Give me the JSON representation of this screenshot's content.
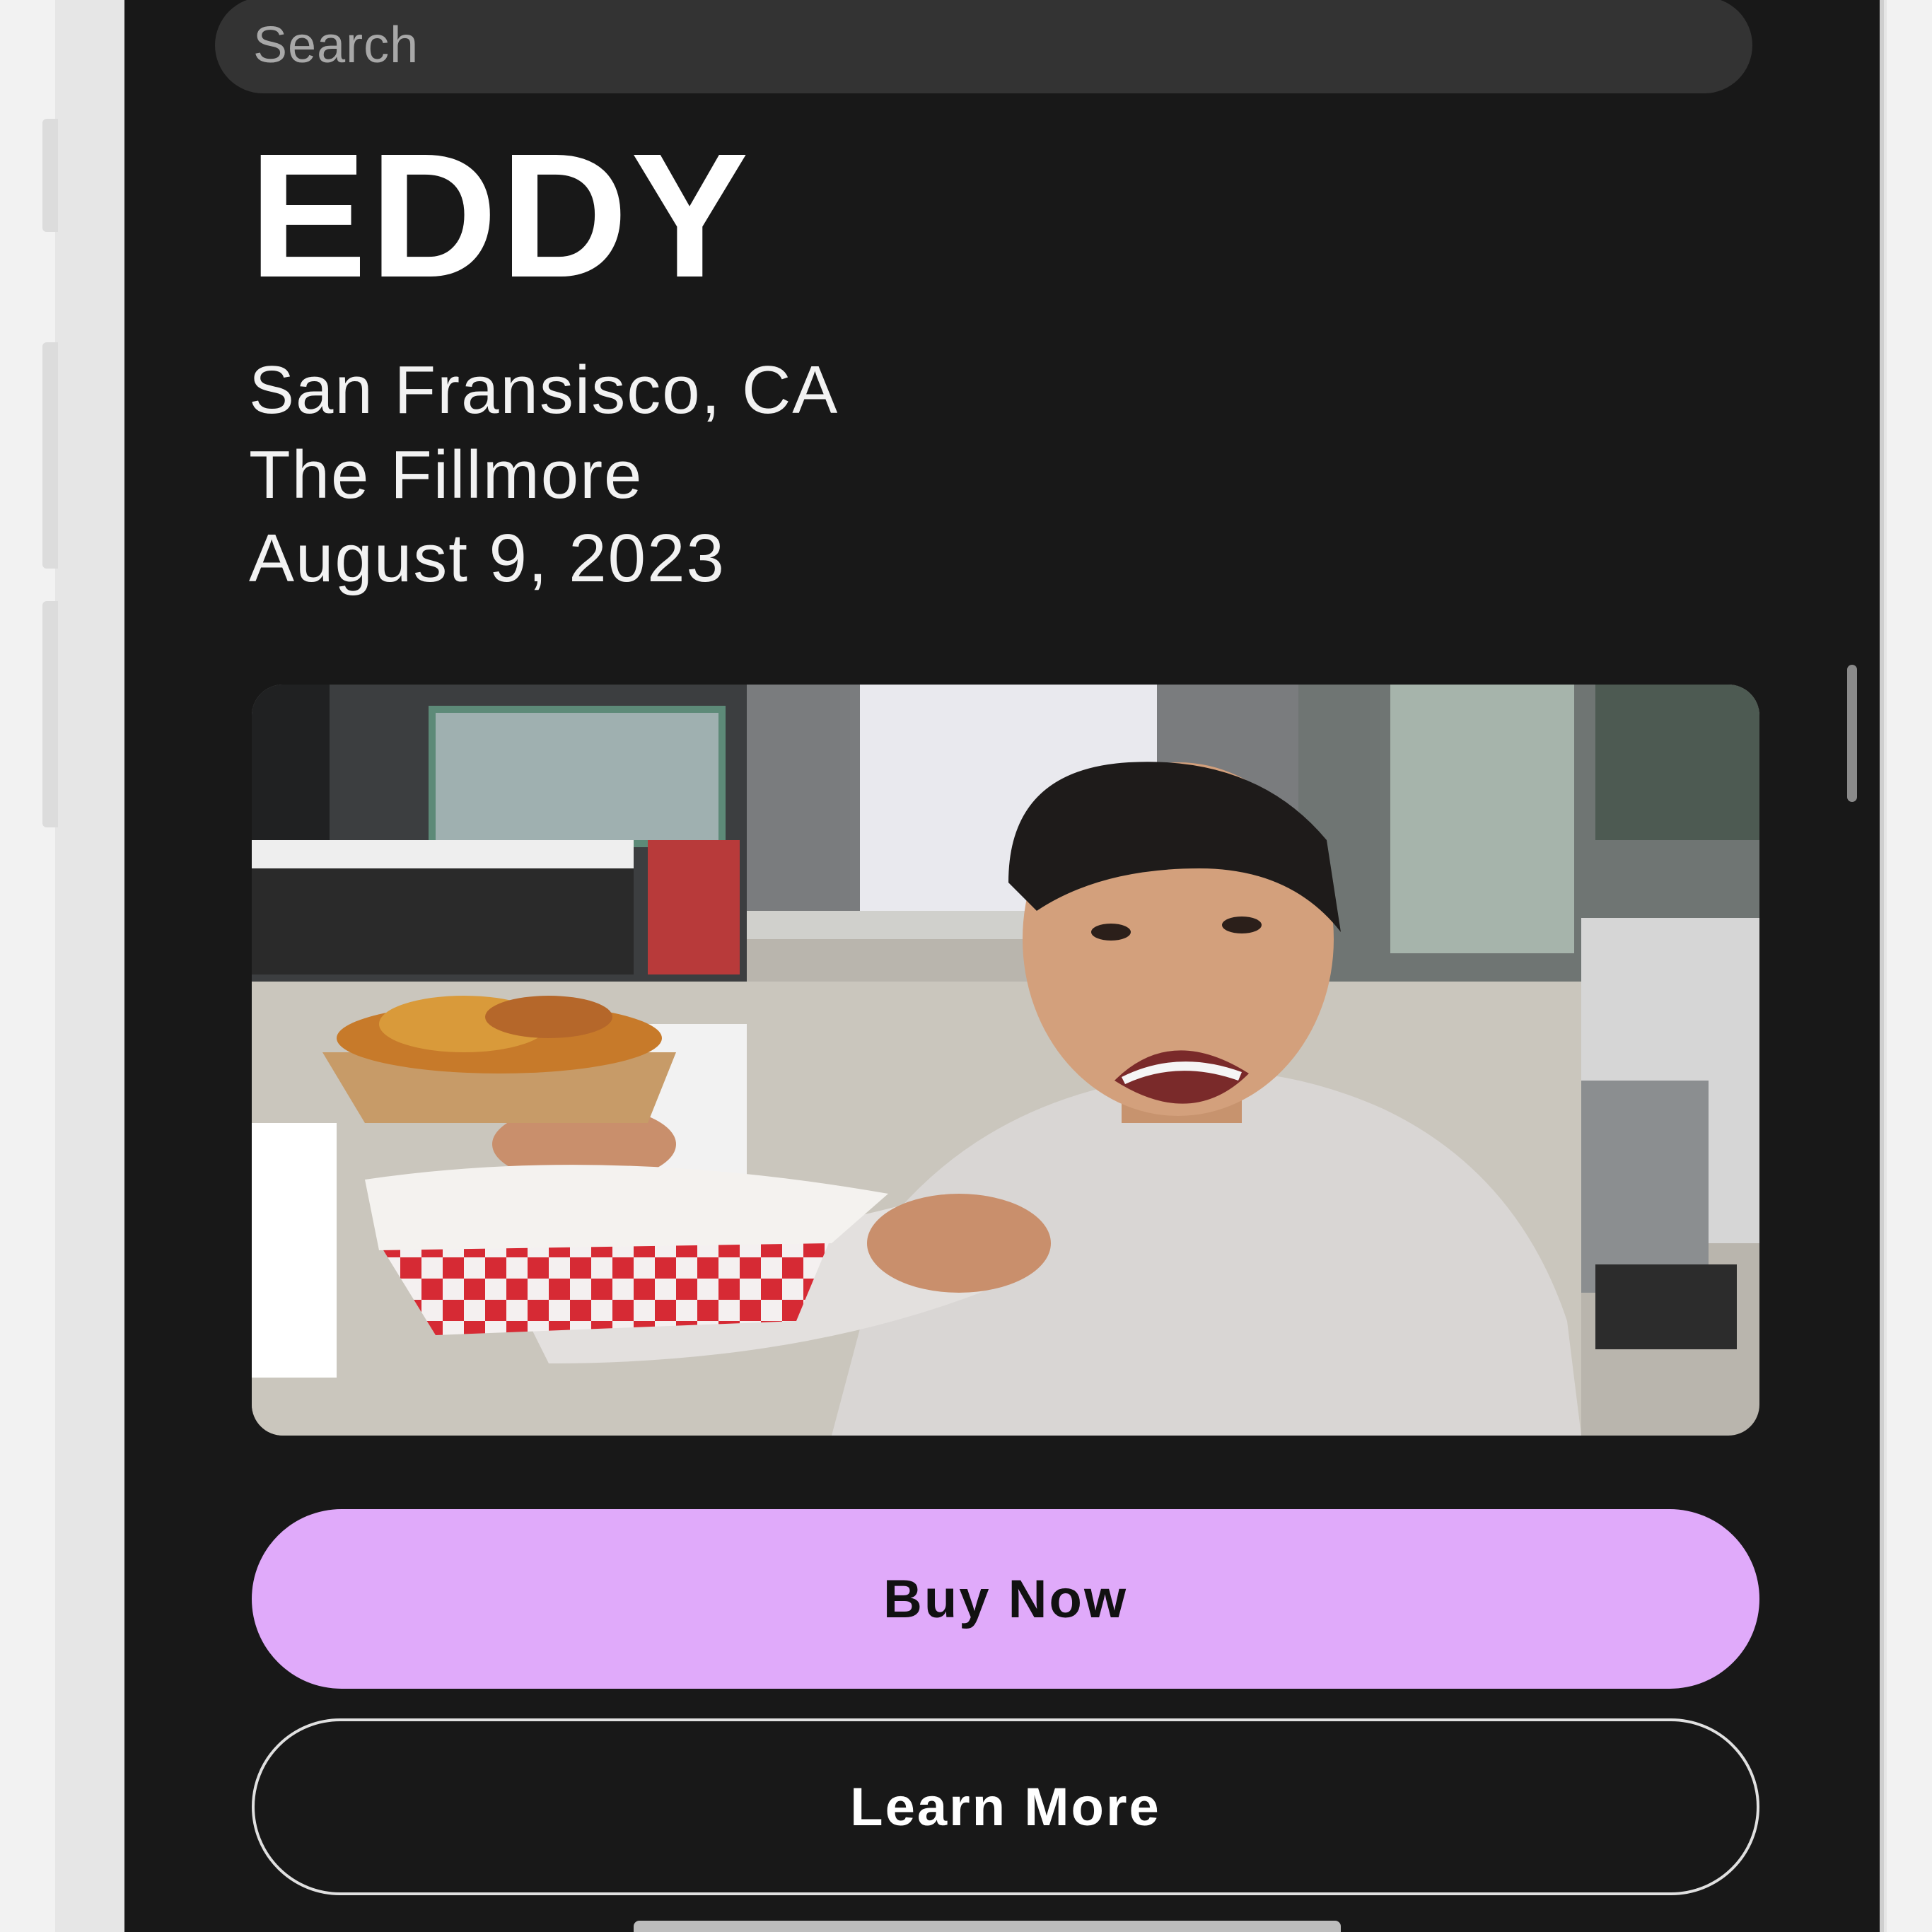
{
  "search": {
    "placeholder": "Search"
  },
  "event": {
    "artist": "EDDY",
    "city": "San Fransisco, CA",
    "venue": "The Fillmore",
    "date": "August 9, 2023"
  },
  "actions": {
    "buy_label": "Buy Now",
    "learn_label": "Learn More"
  },
  "colors": {
    "screen_background": "#181818",
    "buy_button": "#e0aafa",
    "search_field": "#333333"
  }
}
